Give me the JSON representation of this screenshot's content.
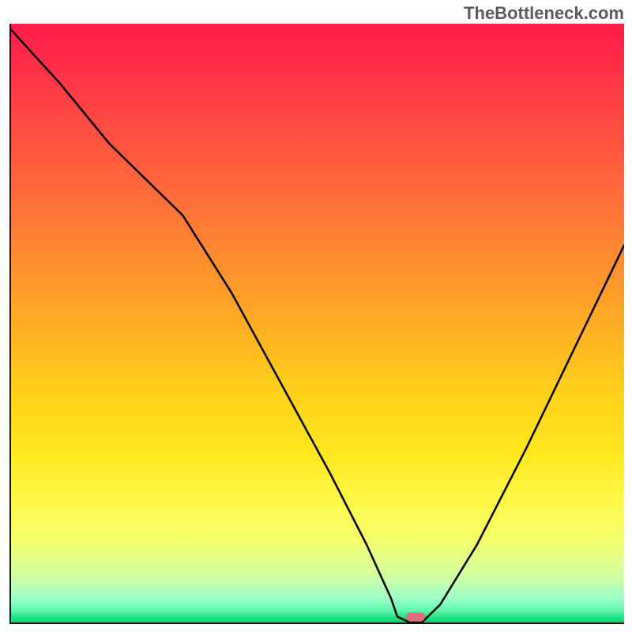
{
  "watermark": "TheBottleneck.com",
  "chart_data": {
    "type": "line",
    "title": "",
    "xlabel": "",
    "ylabel": "",
    "xlim": [
      0,
      100
    ],
    "ylim": [
      0,
      100
    ],
    "series": [
      {
        "name": "curve",
        "x": [
          0,
          8,
          16,
          22,
          28,
          36,
          44,
          52,
          58,
          62,
          63,
          65,
          67,
          70,
          76,
          84,
          92,
          100
        ],
        "y": [
          99,
          90,
          80,
          74,
          68,
          55,
          40,
          25,
          13,
          4,
          1,
          0,
          0,
          3,
          13,
          29,
          46,
          63
        ]
      }
    ],
    "marker": {
      "x": 66,
      "y": 0.9
    },
    "colors": {
      "curve": "#0b0b0b",
      "marker": "#e36b7a",
      "gradient_top": "#ff1a4a",
      "gradient_bottom": "#10e886"
    }
  }
}
